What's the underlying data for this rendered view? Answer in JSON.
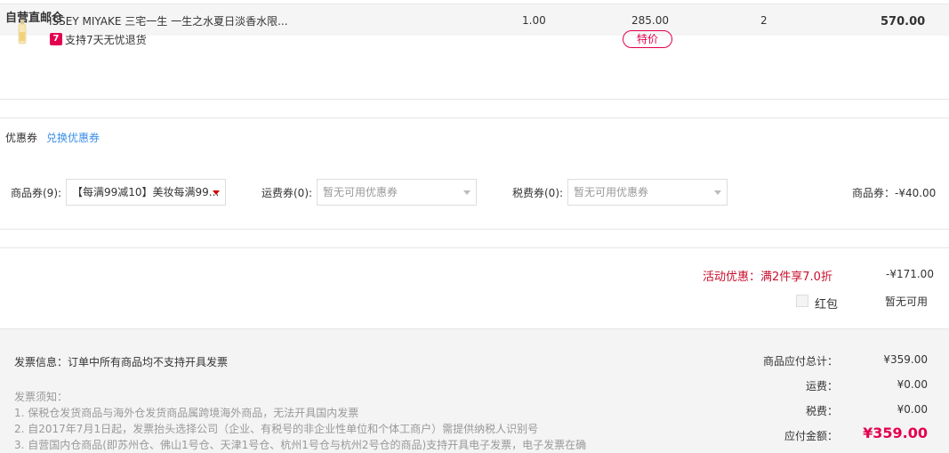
{
  "warehouse": {
    "title": "自营直邮仓"
  },
  "product": {
    "name": "ISSEY MIYAKE 三宅一生 一生之水夏日淡香水限...",
    "return_badge": "7",
    "return_text": "支持7天无忧退货",
    "unit": "1.00",
    "price": "285.00",
    "special_tag": "特价",
    "quantity": "2",
    "subtotal": "570.00"
  },
  "coupon": {
    "label": "优惠券",
    "exchange_link": "兑换优惠券",
    "goods_label": "商品券(9):",
    "goods_selected": "【每满99减10】美妆每满99...",
    "shipping_label": "运费券(0):",
    "shipping_placeholder": "暂无可用优惠券",
    "tax_label": "税费券(0):",
    "tax_placeholder": "暂无可用优惠券",
    "summary": "商品券：-¥40.00"
  },
  "activity": {
    "label": "活动优惠：满2件享7.0折",
    "value": "-¥171.00",
    "hongbao_label": "红包",
    "hongbao_value": "暂无可用"
  },
  "invoice": {
    "info": "发票信息：订单中所有商品均不支持开具发票",
    "notice_title": "发票须知：",
    "lines": [
      "1. 保税仓发货商品与海外仓发货商品属跨境海外商品，无法开具国内发票",
      "2. 自2017年7月1日起，发票抬头选择公司（企业、有税号的非企业性单位和个体工商户）需提供纳税人识别号",
      "3. 自营国内仓商品(即苏州仓、佛山1号仓、天津1号仓、杭州1号仓与杭州2号仓的商品)支持开具电子发票，电子发票在确"
    ]
  },
  "summary": {
    "goods_total_label": "商品应付总计：",
    "goods_total": "¥359.00",
    "shipping_label": "运费：",
    "shipping": "¥0.00",
    "tax_label": "税费：",
    "tax": "¥0.00",
    "pay_label": "应付金额：",
    "pay_total": "¥359.00"
  },
  "colors": {
    "accent": "#e4004f",
    "activity": "#c8102e",
    "link": "#3a8ee6"
  }
}
